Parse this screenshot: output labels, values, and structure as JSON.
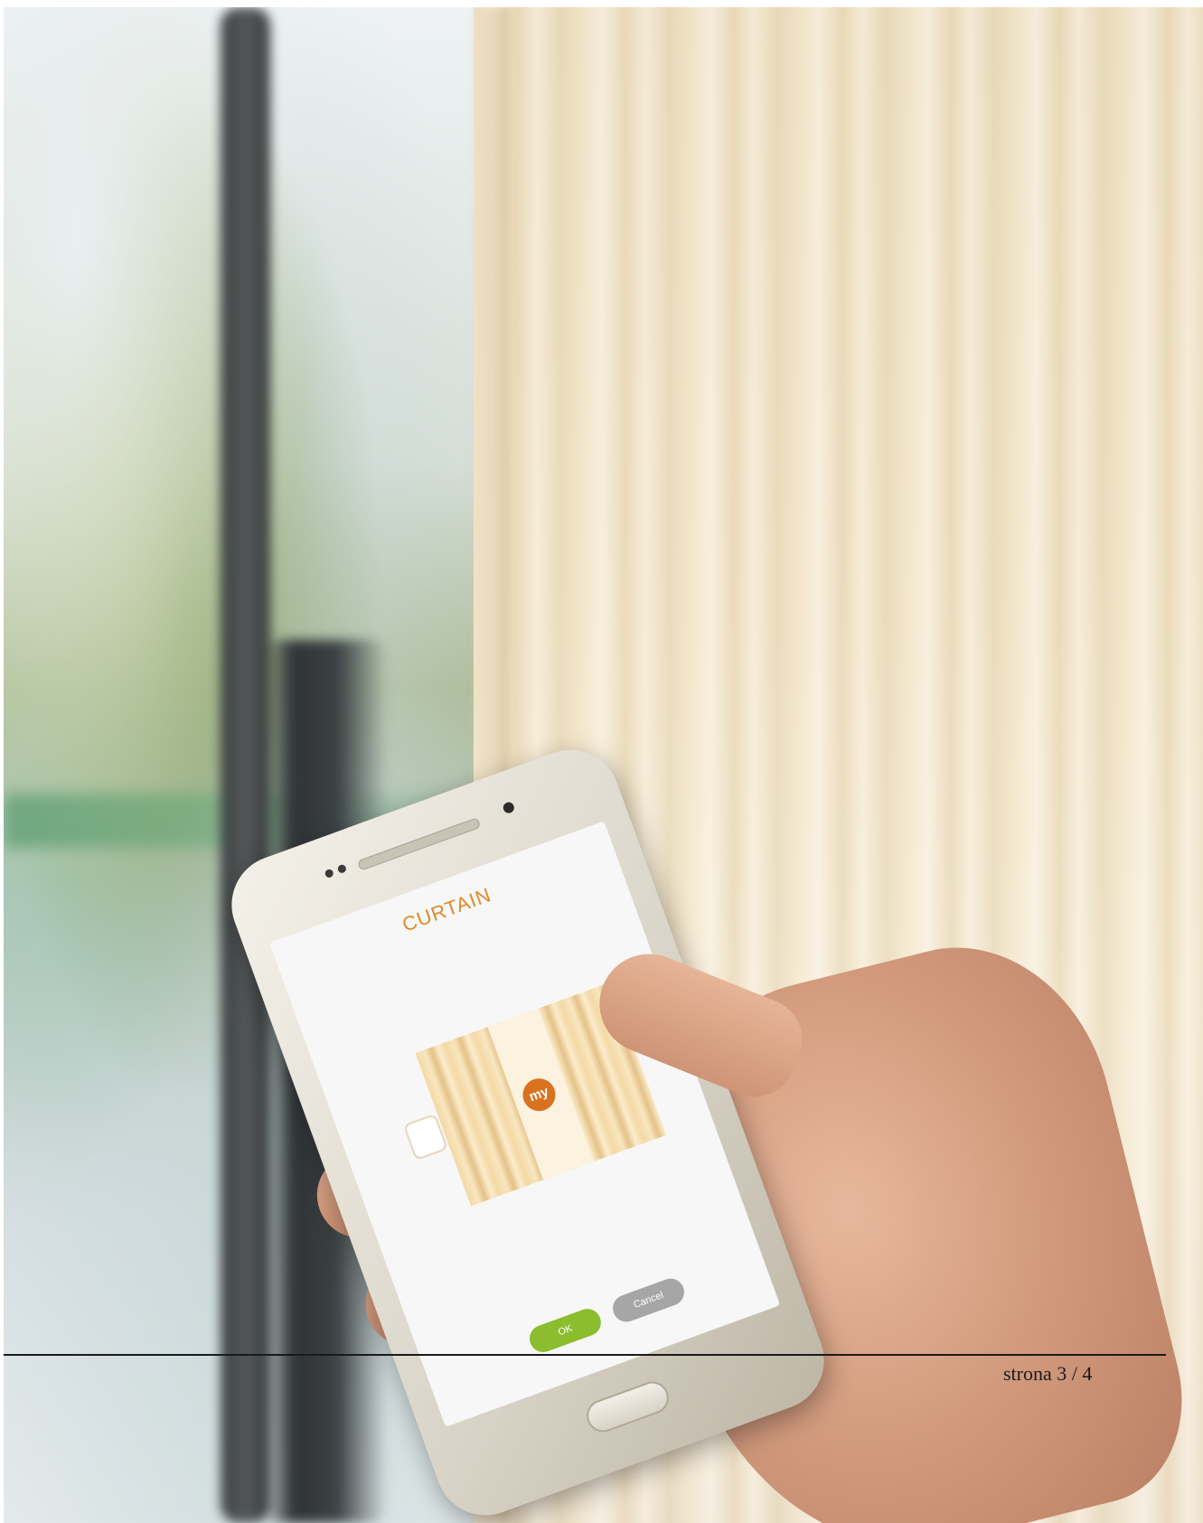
{
  "photo": {
    "phone_screen": {
      "title": "CURTAIN",
      "my_button_label": "my",
      "ok_label": "OK",
      "cancel_label": "Cancel"
    }
  },
  "footer": {
    "page_number": "strona 3 / 4"
  }
}
